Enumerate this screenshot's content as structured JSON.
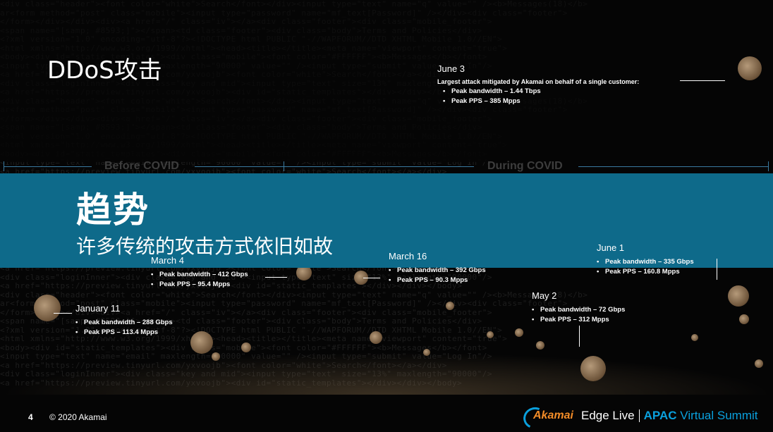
{
  "slide": {
    "title": "DDoS攻击",
    "page_number": "4",
    "copyright": "© 2020 Akamai"
  },
  "banner": {
    "title": "趋势",
    "subtitle": "许多传统的攻击方式依旧如故"
  },
  "periods": {
    "before": "Before COVID",
    "during": "During COVID"
  },
  "events": {
    "jun3": {
      "date": "June 3",
      "description": "Largest attack mitigated by Akamai on behalf of a single customer:",
      "bandwidth": "Peak bandwidth – 1.44 Tbps",
      "pps": "Peak PPS – 385 Mpps"
    },
    "mar4": {
      "date": "March 4",
      "bandwidth": "Peak bandwidth – 412 Gbps",
      "pps": "Peak PPS – 95.4 Mpps"
    },
    "mar16": {
      "date": "March 16",
      "bandwidth": "Peak bandwidth – 392 Gbps",
      "pps": "Peak PPS – 90.3 Mpps"
    },
    "jun1": {
      "date": "June 1",
      "bandwidth": "Peak bandwidth – 335 Gbps",
      "pps": "Peak PPS – 160.8 Mpps"
    },
    "jan11": {
      "date": "January 11",
      "bandwidth": "Peak bandwidth – 288 Gbps",
      "pps": "Peak PPS – 113.4 Mpps"
    },
    "may2": {
      "date": "May 2",
      "bandwidth": "Peak bandwidth – 72 Gbps",
      "pps": "Peak PPS – 312 Mpps"
    }
  },
  "footer": {
    "brand": "Akamai",
    "event": "Edge Live",
    "summit_a": "APAC",
    "summit_b": "Virtual Summit"
  },
  "colors": {
    "banner": "#0e6a8a",
    "timeline": "#3a7aa0",
    "accent_blue": "#0aa0dd",
    "accent_orange": "#f28c28"
  }
}
